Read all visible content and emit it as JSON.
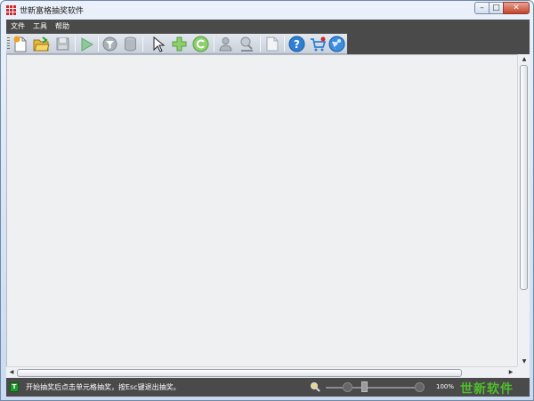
{
  "window": {
    "title": "世新富格抽奖软件"
  },
  "menubar": {
    "items": [
      {
        "label": "文件"
      },
      {
        "label": "工具"
      },
      {
        "label": "帮助"
      }
    ]
  },
  "toolbar": {
    "buttons": [
      {
        "icon": "new-file-icon"
      },
      {
        "icon": "open-folder-icon"
      },
      {
        "icon": "save-icon"
      },
      {
        "icon": "play-icon"
      },
      {
        "icon": "filter-icon"
      },
      {
        "icon": "database-icon"
      },
      {
        "icon": "pointer-icon"
      },
      {
        "icon": "add-icon"
      },
      {
        "icon": "refresh-icon"
      },
      {
        "icon": "users-icon"
      },
      {
        "icon": "user-search-icon"
      },
      {
        "icon": "blank-page-icon"
      },
      {
        "icon": "help-icon"
      },
      {
        "icon": "cart-icon"
      },
      {
        "icon": "globe-icon"
      }
    ]
  },
  "statusbar": {
    "icon_letter": "T",
    "message": "开始抽奖后点击单元格抽奖，按Esc键退出抽奖。",
    "zoom_value": "100%",
    "zoom_level": 0.35,
    "brand": "世新软件"
  },
  "colors": {
    "menubar_bg": "#4a4a4a",
    "brand_green": "#4fbf2a",
    "canvas_bg": "#eff0f2",
    "close_red": "#c4432b"
  }
}
